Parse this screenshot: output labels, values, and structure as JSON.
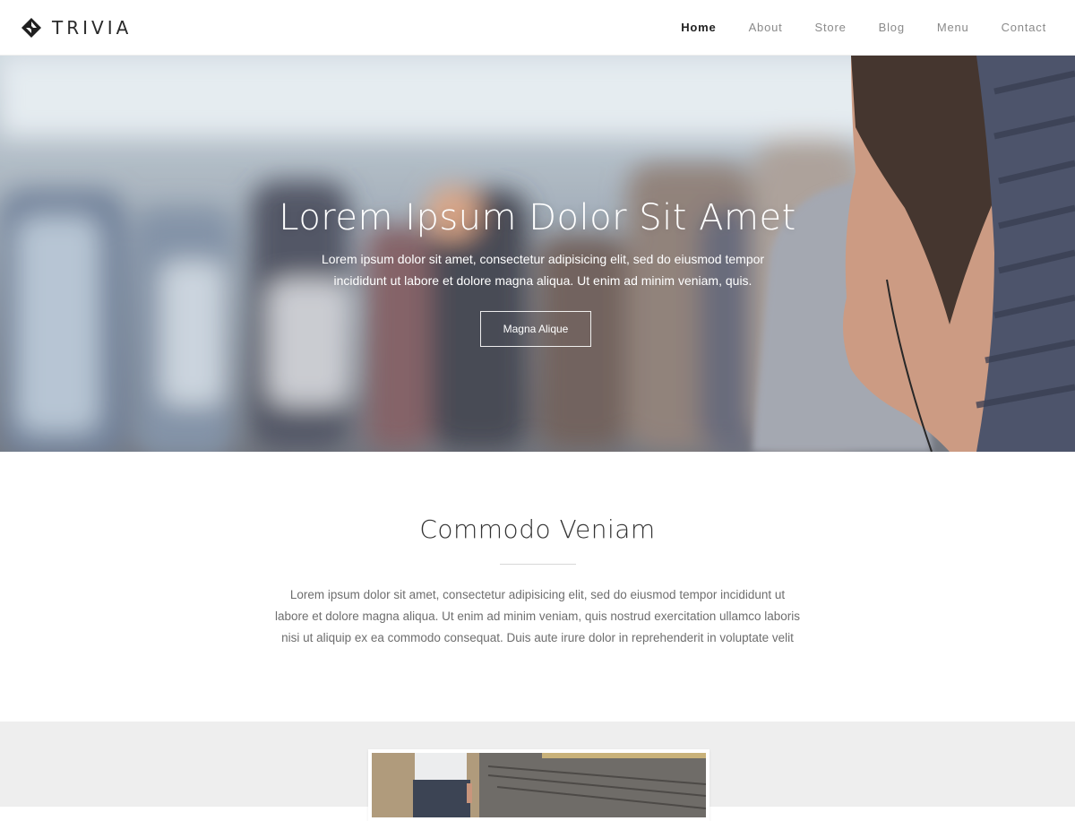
{
  "header": {
    "brand_name": "TRIVIA",
    "brand_icon": "trivia-logo-icon",
    "nav": [
      {
        "label": "Home",
        "active": true
      },
      {
        "label": "About",
        "active": false
      },
      {
        "label": "Store",
        "active": false
      },
      {
        "label": "Blog",
        "active": false
      },
      {
        "label": "Menu",
        "active": false
      },
      {
        "label": "Contact",
        "active": false
      }
    ]
  },
  "hero": {
    "title": "Lorem Ipsum Dolor Sit Amet",
    "text": "Lorem ipsum dolor sit amet, consectetur adipisicing elit, sed do eiusmod tempor incididunt ut labore et dolore magna aliqua. Ut enim ad minim veniam, quis.",
    "button_label": "Magna Alique"
  },
  "intro": {
    "title": "Commodo Veniam",
    "text": "Lorem ipsum dolor sit amet, consectetur adipisicing elit, sed do eiusmod tempor incididunt ut labore et dolore magna aliqua. Ut enim ad minim veniam, quis nostrud exercitation ullamco laboris nisi ut aliquip ex ea commodo consequat. Duis aute irure dolor in reprehenderit in voluptate velit"
  },
  "colors": {
    "nav_active": "#222222",
    "nav_inactive": "#8a8a8a",
    "gallery_bg": "#eeeeee"
  }
}
